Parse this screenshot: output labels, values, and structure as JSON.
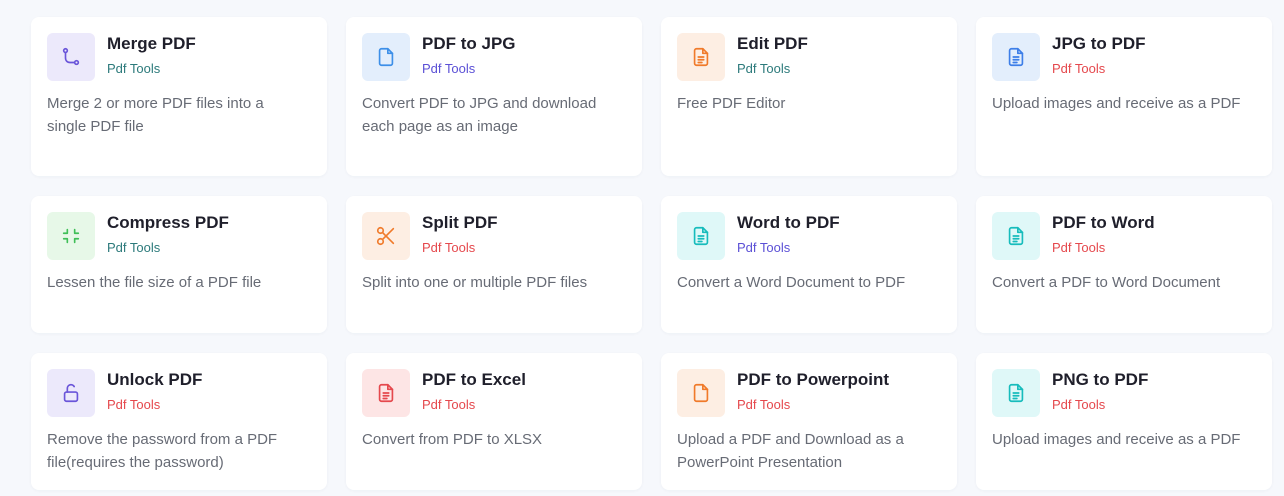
{
  "cards": [
    {
      "title": "Merge PDF",
      "tag": "Pdf Tools",
      "tag_color": "#2c7a7b",
      "desc": "Merge 2 or more PDF files into a single PDF file",
      "icon": "merge-icon",
      "icon_bg": "#ece9fb",
      "icon_color": "#6a55d9"
    },
    {
      "title": "PDF to JPG",
      "tag": "Pdf Tools",
      "tag_color": "#5b50d6",
      "desc": "Convert PDF to JPG and download each page as an image",
      "icon": "file-icon",
      "icon_bg": "#e3eefc",
      "icon_color": "#3d8fe8"
    },
    {
      "title": "Edit PDF",
      "tag": "Pdf Tools",
      "tag_color": "#2c7a7b",
      "desc": "Free PDF Editor",
      "icon": "file-text-icon",
      "icon_bg": "#fdeee3",
      "icon_color": "#f07a2a"
    },
    {
      "title": "JPG to PDF",
      "tag": "Pdf Tools",
      "tag_color": "#e5484d",
      "desc": "Upload images and receive as a PDF",
      "icon": "file-text-icon",
      "icon_bg": "#e3eefc",
      "icon_color": "#3d7ee8"
    },
    {
      "title": "Compress PDF",
      "tag": "Pdf Tools",
      "tag_color": "#2c7a7b",
      "desc": "Lessen the file size of a PDF file",
      "icon": "minimize-icon",
      "icon_bg": "#e7f8e8",
      "icon_color": "#3fbf57"
    },
    {
      "title": "Split PDF",
      "tag": "Pdf Tools",
      "tag_color": "#e5484d",
      "desc": "Split into one or multiple PDF files",
      "icon": "scissors-icon",
      "icon_bg": "#fdeee3",
      "icon_color": "#f07a2a"
    },
    {
      "title": "Word to PDF",
      "tag": "Pdf Tools",
      "tag_color": "#5b50d6",
      "desc": "Convert a Word Document to PDF",
      "icon": "file-text-icon",
      "icon_bg": "#dff8f8",
      "icon_color": "#17bcbc"
    },
    {
      "title": "PDF to Word",
      "tag": "Pdf Tools",
      "tag_color": "#e5484d",
      "desc": "Convert a PDF to Word Document",
      "icon": "file-text-icon",
      "icon_bg": "#dff8f8",
      "icon_color": "#17bcbc"
    },
    {
      "title": "Unlock PDF",
      "tag": "Pdf Tools",
      "tag_color": "#e5484d",
      "desc": "Remove the password from a PDF file(requires the password)",
      "icon": "unlock-icon",
      "icon_bg": "#ece9fb",
      "icon_color": "#6a55d9"
    },
    {
      "title": "PDF to Excel",
      "tag": "Pdf Tools",
      "tag_color": "#e5484d",
      "desc": "Convert from PDF to XLSX",
      "icon": "file-text-icon",
      "icon_bg": "#fde5e5",
      "icon_color": "#e5484d"
    },
    {
      "title": "PDF to Powerpoint",
      "tag": "Pdf Tools",
      "tag_color": "#e5484d",
      "desc": "Upload a PDF and Download as a PowerPoint Presentation",
      "icon": "file-icon",
      "icon_bg": "#fdeee3",
      "icon_color": "#f07a2a"
    },
    {
      "title": "PNG to PDF",
      "tag": "Pdf Tools",
      "tag_color": "#e5484d",
      "desc": "Upload images and receive as a PDF",
      "icon": "file-text-icon",
      "icon_bg": "#dff8f8",
      "icon_color": "#17bcbc"
    }
  ]
}
